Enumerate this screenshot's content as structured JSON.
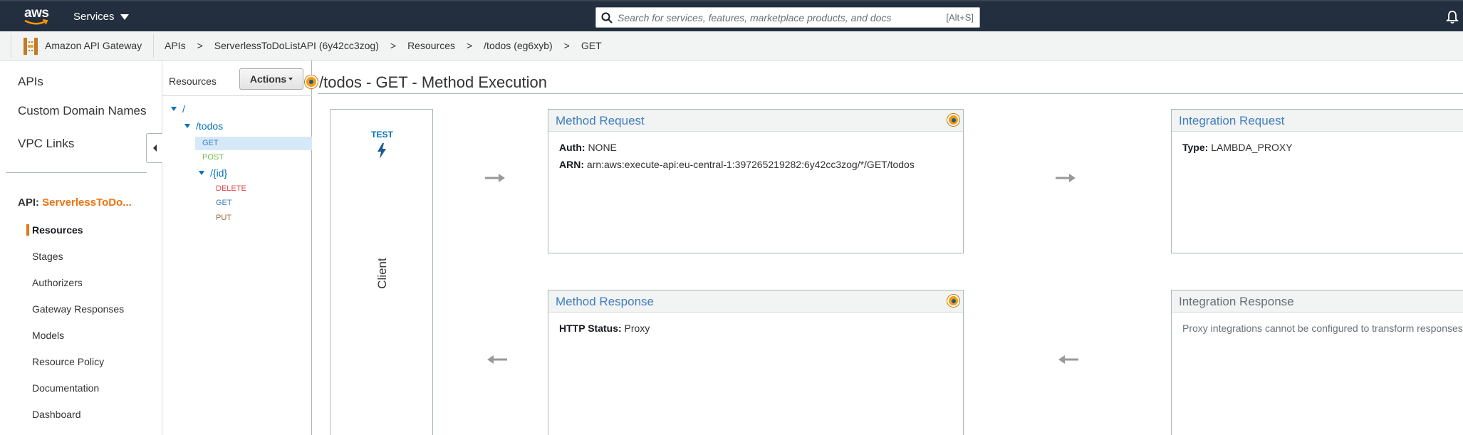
{
  "topnav": {
    "logo_text": "aws",
    "services_label": "Services",
    "search_placeholder": "Search for services, features, marketplace products, and docs",
    "search_shortcut": "[Alt+S]"
  },
  "breadcrumb": {
    "service_name": "Amazon API Gateway",
    "items": [
      "APIs",
      "ServerlessToDoListAPI (6y42cc3zog)",
      "Resources",
      "/todos (eg6xyb)",
      "GET"
    ],
    "separator": ">"
  },
  "leftnav": {
    "top_items": [
      "APIs",
      "Custom Domain Names",
      "VPC Links"
    ],
    "api_prefix": "API:",
    "api_name": "ServerlessToDo...",
    "sub_items": [
      "Resources",
      "Stages",
      "Authorizers",
      "Gateway Responses",
      "Models",
      "Resource Policy",
      "Documentation",
      "Dashboard"
    ],
    "active_sub_item": "Resources"
  },
  "resources": {
    "title": "Resources",
    "actions_label": "Actions",
    "tree": {
      "root": "/",
      "todos": "/todos",
      "todos_methods": [
        "GET",
        "POST"
      ],
      "id": "/{id}",
      "id_methods": [
        "DELETE",
        "GET",
        "PUT"
      ]
    },
    "method_colors": {
      "GET": "#3f7fbf",
      "POST": "#6fbf4b",
      "DELETE": "#e0484d",
      "PUT": "#9e6b3c"
    }
  },
  "main": {
    "title": "/todos - GET - Method Execution",
    "client": {
      "test_label": "TEST",
      "label": "Client"
    },
    "method_request": {
      "title": "Method Request",
      "auth_label": "Auth:",
      "auth_value": "NONE",
      "arn_label": "ARN:",
      "arn_value": "arn:aws:execute-api:eu-central-1:397265219282:6y42cc3zog/*/GET/todos"
    },
    "integration_request": {
      "title": "Integration Request",
      "type_label": "Type:",
      "type_value": "LAMBDA_PROXY"
    },
    "method_response": {
      "title": "Method Response",
      "status_label": "HTTP Status:",
      "status_value": "Proxy"
    },
    "integration_response": {
      "title": "Integration Response",
      "note": "Proxy integrations cannot be configured to transform responses"
    }
  },
  "colors": {
    "nav_bg": "#232f3e",
    "accent_orange": "#ec7211",
    "link_blue": "#0073bb",
    "panel_title_blue": "#3f7fbf"
  }
}
